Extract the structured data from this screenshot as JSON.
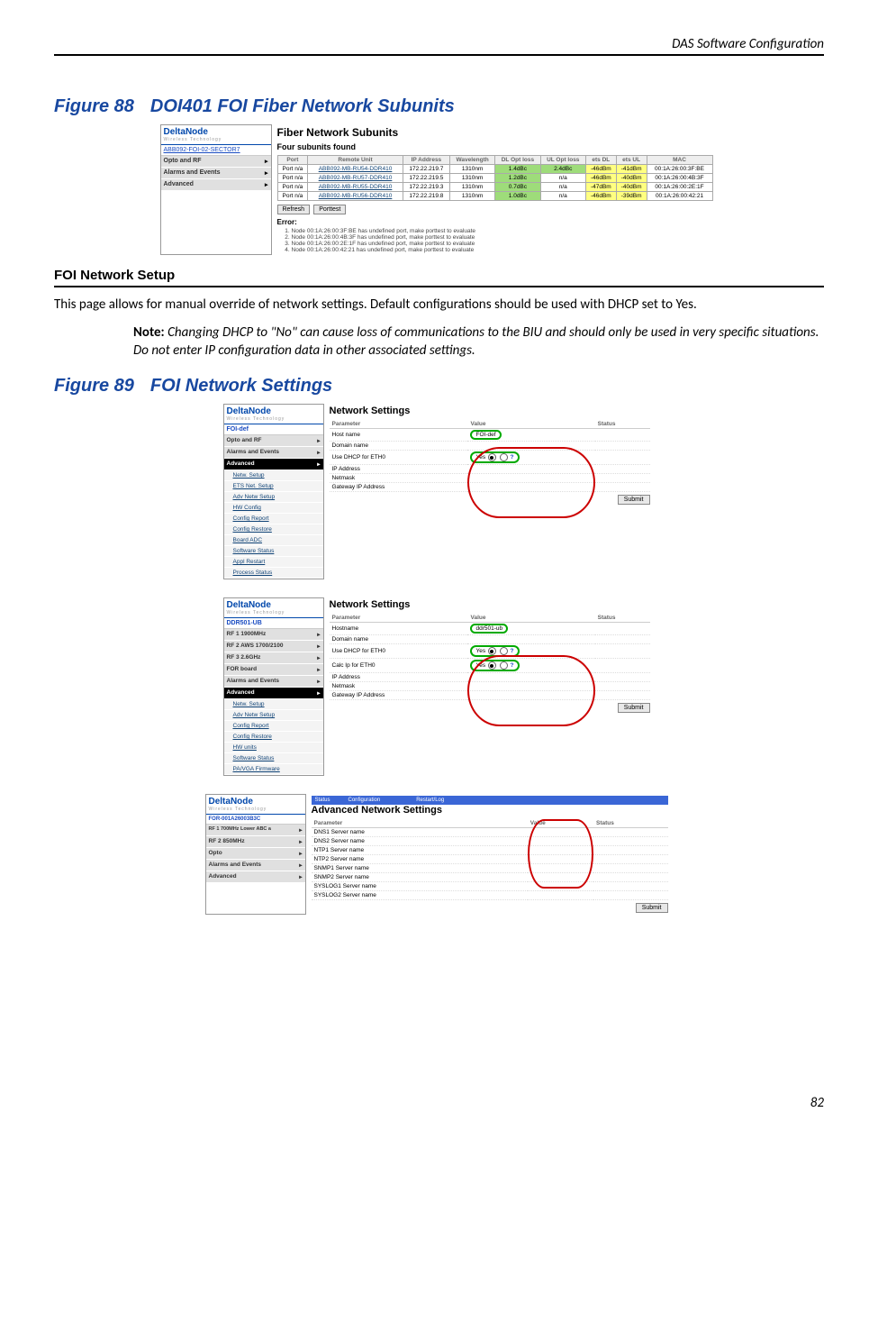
{
  "running_head": "DAS Software Configuration",
  "page_number": "82",
  "fig88": {
    "caption_prefix": "Figure 88",
    "caption_title": "DOI401 FOI Fiber Network Subunits",
    "logo": "DeltaNode",
    "logo_sub": "Wireless Technology",
    "breadcrumb": "ABB092-FOI-02-SECTOR7",
    "nav": [
      "Opto and RF",
      "Alarms and Events",
      "Advanced"
    ],
    "title": "Fiber Network Subunits",
    "subtitle": "Four subunits found",
    "columns": [
      "Port",
      "Remote Unit",
      "IP Address",
      "Wavelength",
      "DL Opt loss",
      "UL Opt loss",
      "ets DL",
      "ets UL",
      "MAC"
    ],
    "rows": [
      {
        "port": "Port n/a",
        "unit": "ABB092-MB-RU54-DDR410",
        "ip": "172.22.219.7",
        "wl": "1310nm",
        "dl": "1.4dBc",
        "ul": "2.4dBc",
        "edl": "-46dBm",
        "eul": "-41dBm",
        "mac": "00:1A:26:00:3F:BE"
      },
      {
        "port": "Port n/a",
        "unit": "ABB092-MB-RU57-DDR410",
        "ip": "172.22.219.5",
        "wl": "1310nm",
        "dl": "1.2dBc",
        "ul": "n/a",
        "edl": "-46dBm",
        "eul": "-40dBm",
        "mac": "00:1A:26:00:4B:3F"
      },
      {
        "port": "Port n/a",
        "unit": "ABB092-MB-RU55-DDR410",
        "ip": "172.22.219.3",
        "wl": "1310nm",
        "dl": "0.7dBc",
        "ul": "n/a",
        "edl": "-47dBm",
        "eul": "-40dBm",
        "mac": "00:1A:26:00:2E:1F"
      },
      {
        "port": "Port n/a",
        "unit": "ABB092-MB-RU56-DDR410",
        "ip": "172.22.219.8",
        "wl": "1310nm",
        "dl": "1.0dBc",
        "ul": "n/a",
        "edl": "-46dBm",
        "eul": "-39dBm",
        "mac": "00:1A:26:00:42:21"
      }
    ],
    "btn_refresh": "Refresh",
    "btn_porttest": "Porttest",
    "error_label": "Error:",
    "errors": [
      "Node 00:1A:26:00:3F:BE has undefined port, make porttest to evaluate",
      "Node 00:1A:26:00:4B:3F has undefined port, make porttest to evaluate",
      "Node 00:1A:26:00:2E:1F has undefined port, make porttest to evaluate",
      "Node 00:1A:26:00:42:21 has undefined port, make porttest to evaluate"
    ]
  },
  "section": {
    "heading": "FOI Network Setup",
    "body": "This page allows for manual override of network settings. Default configurations should be used with DHCP set to Yes.",
    "note_label": "Note:",
    "note_body": "Changing DHCP to \"No\" can cause loss of communications to the BIU and should only be used in very specific situations.   Do not enter IP configuration data in other associated settings."
  },
  "fig89": {
    "caption_prefix": "Figure 89",
    "caption_title": "FOI Network Settings",
    "submit": "Submit",
    "col_param": "Parameter",
    "col_value": "Value",
    "col_status": "Status",
    "panel1": {
      "hd": "FOI-def",
      "nav": [
        "Opto and RF",
        "Alarms and Events"
      ],
      "nav_open": "Advanced",
      "subs": [
        "Netw. Setup",
        "ETS Net. Setup",
        "Adv Netw Setup",
        "HW Config",
        "Config Report",
        "Config Restore",
        "Board ADC",
        "Software Status",
        "Appl Restart",
        "Process Status"
      ],
      "title": "Network Settings",
      "rows": [
        {
          "p": "Host name",
          "v": "FOI-def"
        },
        {
          "p": "Domain name",
          "v": ""
        },
        {
          "p": "Use DHCP for ETH0",
          "v": "Yes / No ?",
          "yes": "Yes",
          "no": "No"
        },
        {
          "p": "IP Address",
          "v": ""
        },
        {
          "p": "Netmask",
          "v": ""
        },
        {
          "p": "Gateway IP Address",
          "v": ""
        }
      ]
    },
    "panel2": {
      "hd": "DDR501-UB",
      "nav": [
        "RF 1 1900MHz",
        "RF 2 AWS 1700/2100",
        "RF 3 2.6GHz",
        "FOR board",
        "Alarms and Events"
      ],
      "nav_open": "Advanced",
      "subs": [
        "Netw. Setup",
        "Adv Netw Setup",
        "Config Report",
        "Config Restore",
        "HW units",
        "Software Status",
        "PA/VGA Firmware"
      ],
      "title": "Network Settings",
      "rows": [
        {
          "p": "Hostname",
          "v": "ddr501-ub"
        },
        {
          "p": "Domain name",
          "v": ""
        },
        {
          "p": "Use DHCP for ETH0",
          "yes": "Yes",
          "no": "No"
        },
        {
          "p": "Calc Ip for ETH0",
          "yes": "Yes",
          "no": "No"
        },
        {
          "p": "IP Address",
          "v": ""
        },
        {
          "p": "Netmask",
          "v": ""
        },
        {
          "p": "Gateway IP Address",
          "v": ""
        }
      ]
    },
    "panel3": {
      "tabs": [
        "Status",
        "Configuration",
        "",
        "Restart/Log"
      ],
      "hd": "FOR-001A26003B3C",
      "nav": [
        "RF 1 700MHz Lower ABC a",
        "RF 2 850MHz",
        "Opto",
        "Alarms and Events",
        "Advanced"
      ],
      "title": "Advanced Network Settings",
      "rows": [
        {
          "p": "DNS1 Server name",
          "v": ""
        },
        {
          "p": "DNS2 Server name",
          "v": ""
        },
        {
          "p": "NTP1 Server name",
          "v": ""
        },
        {
          "p": "NTP2 Server name",
          "v": ""
        },
        {
          "p": "SNMP1 Server name",
          "v": ""
        },
        {
          "p": "SNMP2 Server name",
          "v": ""
        },
        {
          "p": "SYSLOG1 Server name",
          "v": ""
        },
        {
          "p": "SYSLOG2 Server name",
          "v": ""
        }
      ]
    }
  }
}
